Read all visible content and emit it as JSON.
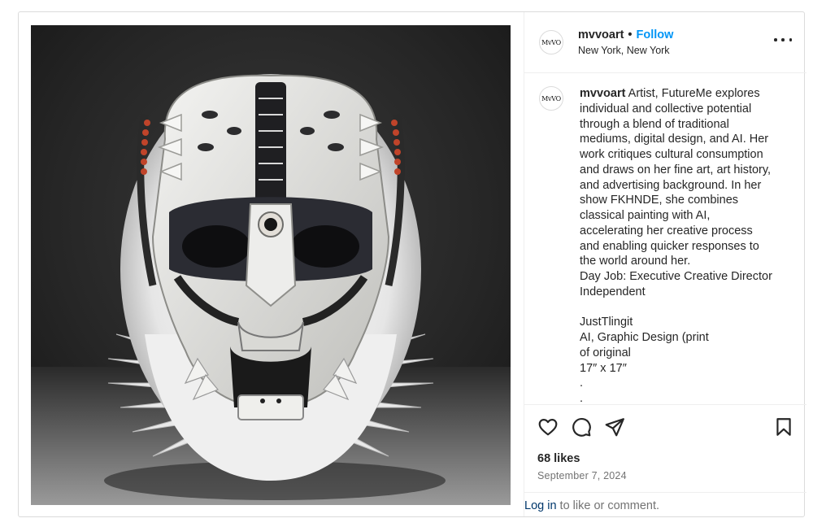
{
  "post": {
    "image_alt": "Sculptural white leather mask with fur trim, dark eye openings and spiked fringe",
    "author": {
      "username": "mvvoart",
      "avatar_text": "MvVO",
      "location": "New York, New York"
    },
    "header": {
      "separator": "•",
      "follow_label": "Follow"
    },
    "caption": {
      "username": "mvvoart",
      "first_line_rest": " Artist, FutureMe explores",
      "lines": [
        "individual and collective potential",
        "through a blend of traditional",
        "mediums, digital design, and AI. Her",
        "work critiques cultural consumption",
        "and draws on her fine art, art history,",
        "and advertising background. In her",
        "show FKHNDE, she combines",
        "classical painting with AI,",
        "accelerating her creative process",
        "and enabling quicker responses to",
        "the world around her.",
        "Day Job: Executive Creative Director",
        "Independent",
        "",
        "JustTlingit",
        "AI, Graphic Design (print",
        "of original",
        "17″ x 17″",
        ".",
        "."
      ]
    },
    "stats": {
      "likes": "68 likes",
      "date": "September 7, 2024"
    },
    "footer": {
      "login_label": "Log in",
      "login_rest": " to like or comment."
    },
    "icons": {
      "like": "heart-icon",
      "comment": "comment-icon",
      "share": "share-icon",
      "save": "bookmark-icon",
      "more": "more-options-icon"
    },
    "colors": {
      "follow": "#0095f6",
      "login_link": "#00376b",
      "muted": "#737373",
      "text": "#262626",
      "border": "#dbdbdb"
    }
  }
}
